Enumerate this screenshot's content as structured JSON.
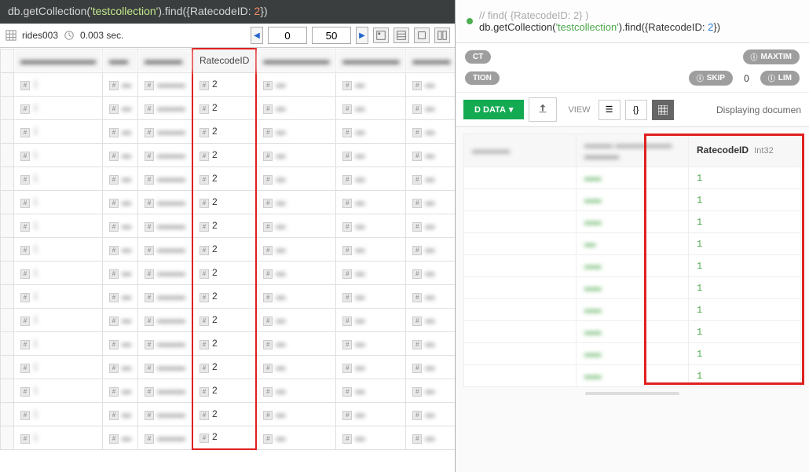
{
  "left": {
    "query": {
      "prefix": "db",
      "getc": ".getCollection(",
      "coll": "'testcollection'",
      "find": ").find({",
      "field": "RatecodeID: ",
      "val": "2",
      "close": "})"
    },
    "status": {
      "collection": "rides003",
      "time": "0.003 sec.",
      "offset": "0",
      "limit": "50"
    },
    "headers": [
      "▬▬▬▬▬▬▬▬",
      "▬▬",
      "▬▬▬▬",
      "RatecodeID",
      "▬▬▬▬▬▬▬",
      "▬▬▬▬▬▬",
      "▬▬▬▬"
    ],
    "rows": [
      {
        "c0": "1",
        "c1": "▬",
        "c2": "▬▬▬",
        "rc": "2",
        "c4": "▬",
        "c5": "▬",
        "c6": "▬"
      },
      {
        "c0": "1",
        "c1": "▬",
        "c2": "▬▬▬",
        "rc": "2",
        "c4": "▬",
        "c5": "▬",
        "c6": "▬"
      },
      {
        "c0": "1",
        "c1": "▬",
        "c2": "▬▬▬",
        "rc": "2",
        "c4": "▬",
        "c5": "▬",
        "c6": "▬"
      },
      {
        "c0": "1",
        "c1": "▬",
        "c2": "▬▬▬",
        "rc": "2",
        "c4": "▬",
        "c5": "▬",
        "c6": "▬"
      },
      {
        "c0": "1",
        "c1": "▬",
        "c2": "▬▬▬",
        "rc": "2",
        "c4": "▬",
        "c5": "▬",
        "c6": "▬"
      },
      {
        "c0": "1",
        "c1": "▬",
        "c2": "▬▬▬",
        "rc": "2",
        "c4": "▬",
        "c5": "▬",
        "c6": "▬"
      },
      {
        "c0": "1",
        "c1": "▬",
        "c2": "▬▬▬",
        "rc": "2",
        "c4": "▬",
        "c5": "▬",
        "c6": "▬"
      },
      {
        "c0": "1",
        "c1": "▬",
        "c2": "▬▬▬",
        "rc": "2",
        "c4": "▬",
        "c5": "▬",
        "c6": "▬"
      },
      {
        "c0": "1",
        "c1": "▬",
        "c2": "▬▬▬",
        "rc": "2",
        "c4": "▬",
        "c5": "▬",
        "c6": "▬"
      },
      {
        "c0": "1",
        "c1": "▬",
        "c2": "▬▬▬",
        "rc": "2",
        "c4": "▬",
        "c5": "▬",
        "c6": "▬"
      },
      {
        "c0": "1",
        "c1": "▬",
        "c2": "▬▬▬",
        "rc": "2",
        "c4": "▬",
        "c5": "▬",
        "c6": "▬"
      },
      {
        "c0": "1",
        "c1": "▬",
        "c2": "▬▬▬",
        "rc": "2",
        "c4": "▬",
        "c5": "▬",
        "c6": "▬"
      },
      {
        "c0": "1",
        "c1": "▬",
        "c2": "▬▬▬",
        "rc": "2",
        "c4": "▬",
        "c5": "▬",
        "c6": "▬"
      },
      {
        "c0": "1",
        "c1": "▬",
        "c2": "▬▬▬",
        "rc": "2",
        "c4": "▬",
        "c5": "▬",
        "c6": "▬"
      },
      {
        "c0": "1",
        "c1": "▬",
        "c2": "▬▬▬",
        "rc": "2",
        "c4": "▬",
        "c5": "▬",
        "c6": "▬"
      },
      {
        "c0": "1",
        "c1": "▬",
        "c2": "▬▬▬",
        "rc": "2",
        "c4": "▬",
        "c5": "▬",
        "c6": "▬"
      }
    ]
  },
  "right": {
    "query": {
      "comment": "// find( {RatecodeID: 2} )",
      "code_prefix": "db.getCollection(",
      "coll": "'testcollection'",
      "mid": ").find({RatecodeID: ",
      "val": "2",
      "end": "})"
    },
    "pills": {
      "maxtime": "MAXTIM",
      "tion": "TION",
      "skip": "SKIP",
      "skip_val": "0",
      "lim": "LIM"
    },
    "toolbar": {
      "data_btn": "D DATA",
      "view_label": "VIEW",
      "display": "Displaying documen"
    },
    "table": {
      "headers": [
        {
          "name": "▬▬▬▬",
          "type": ""
        },
        {
          "name": "▬▬▬ ▬▬▬▬▬▬",
          "type": "▬▬▬▬"
        },
        {
          "name": "RatecodeID",
          "type": "Int32"
        }
      ],
      "rows": [
        {
          "c0": "",
          "c1": "▬▬▬",
          "rc": "1"
        },
        {
          "c0": "",
          "c1": "▬▬▬",
          "rc": "1"
        },
        {
          "c0": "",
          "c1": "▬▬▬",
          "rc": "1"
        },
        {
          "c0": "",
          "c1": "▬▬",
          "rc": "1"
        },
        {
          "c0": "",
          "c1": "▬▬▬",
          "rc": "1"
        },
        {
          "c0": "",
          "c1": "▬▬▬",
          "rc": "1"
        },
        {
          "c0": "",
          "c1": "▬▬▬",
          "rc": "1"
        },
        {
          "c0": "",
          "c1": "▬▬▬",
          "rc": "1"
        },
        {
          "c0": "",
          "c1": "▬▬▬",
          "rc": "1"
        },
        {
          "c0": "",
          "c1": "▬▬▬",
          "rc": "1"
        }
      ]
    }
  },
  "badges": {
    "ct": "CT"
  }
}
